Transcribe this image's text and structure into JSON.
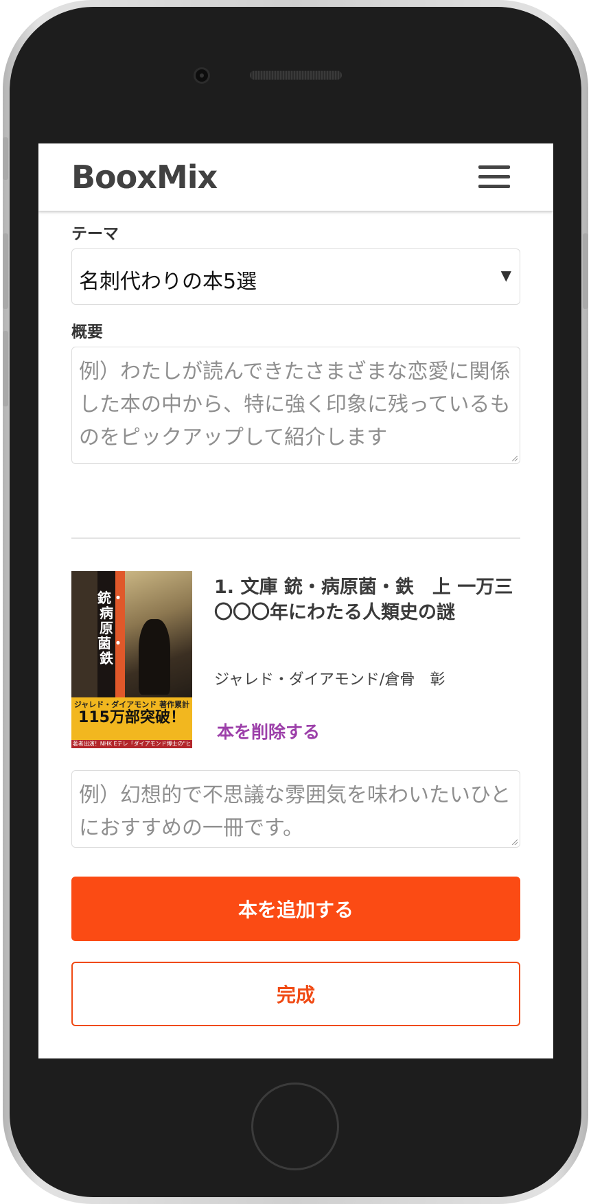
{
  "app": {
    "logo": "BooxMix"
  },
  "header": {
    "menu_icon": "hamburger-menu-icon"
  },
  "theme": {
    "label": "テーマ",
    "selected": "名刺代わりの本5選",
    "arrow": "▼"
  },
  "summary": {
    "label": "概要",
    "placeholder": "例）わたしが読んできたさまざまな恋愛に関係した本の中から、特に強く印象に残っているものをピックアップして紹介します"
  },
  "book": {
    "title": "1. 文庫 銃・病原菌・鉄　上 一万三〇〇〇年にわたる人類史の謎",
    "author": "ジャレド・ダイアモンド/倉骨　彰",
    "delete_label": "本を削除する",
    "comment_placeholder": "例）幻想的で不思議な雰囲気を味わいたいひとにおすすめの一冊です。",
    "cover": {
      "title": "銃・病原菌・鉄",
      "band_small": "ジャレド・ダイアモンド 著作累計",
      "band_big": "115万部突破！",
      "band_foot": "著者出演！NHK Eテレ「ダイアモンド博士の\"ヒトの秘密\"」"
    }
  },
  "actions": {
    "add_label": "本を追加する",
    "done_label": "完成"
  },
  "colors": {
    "accent_orange": "#fb4b14",
    "delete_purple": "#9c3fa9",
    "frame_dark": "#1d1d1d"
  }
}
